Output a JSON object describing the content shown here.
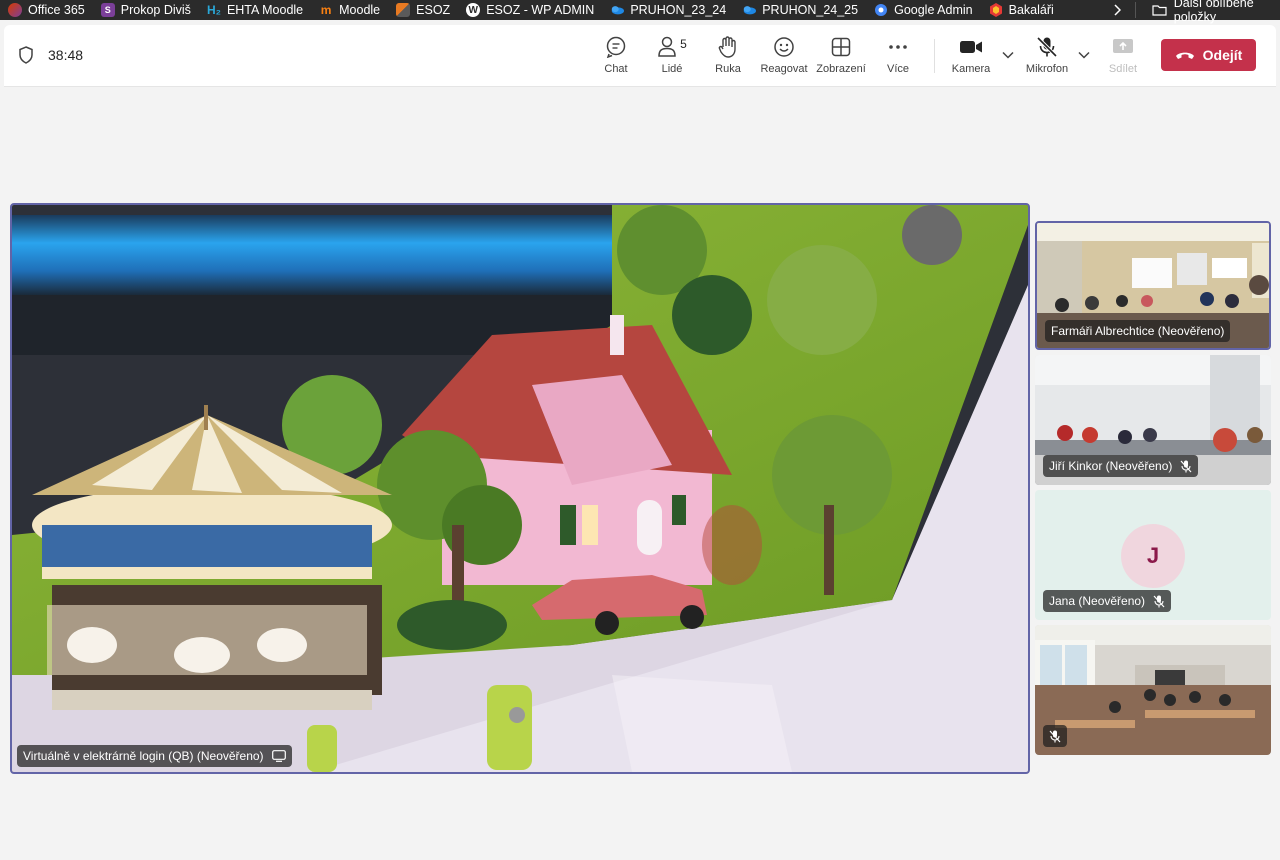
{
  "bookmarks": [
    {
      "label": "Office 365",
      "icon": "office-icon",
      "color": "#d83b01"
    },
    {
      "label": "Prokop Diviš",
      "icon": "prokop-icon",
      "color": "#7b3f99"
    },
    {
      "label": "EHTA Moodle",
      "icon": "ehta-h2-icon",
      "color": "#2aa8d8"
    },
    {
      "label": "Moodle",
      "icon": "moodle-icon",
      "color": "#f98012"
    },
    {
      "label": "ESOZ",
      "icon": "esoz-icon",
      "color": "#e87a22"
    },
    {
      "label": "ESOZ - WP ADMIN",
      "icon": "wordpress-icon",
      "color": "#ffffff"
    },
    {
      "label": "PRUHON_23_24",
      "icon": "onedrive-icon",
      "color": "#1e88e5"
    },
    {
      "label": "PRUHON_24_25",
      "icon": "onedrive-icon",
      "color": "#1e88e5"
    },
    {
      "label": "Google Admin",
      "icon": "google-admin-icon",
      "color": "#4285f4"
    },
    {
      "label": "Bakaláři",
      "icon": "bakalari-icon",
      "color": "#e53935"
    }
  ],
  "other_bookmarks": "Další oblíbené položky",
  "meeting": {
    "timer": "38:48",
    "people_count": "5",
    "buttons": {
      "chat": "Chat",
      "people": "Lidé",
      "hand": "Ruka",
      "react": "Reagovat",
      "view": "Zobrazení",
      "more": "Více",
      "camera": "Kamera",
      "mic": "Mikrofon",
      "share": "Sdílet"
    },
    "leave": "Odejít"
  },
  "stage": {
    "name": "Virtuálně v elektrárně login (QB) (Neověřeno)"
  },
  "participants": [
    {
      "name": "Farmáři Albrechtice (Neověřeno)",
      "muted": false
    },
    {
      "name": "Jiří Kinkor (Neověřeno)",
      "muted": true
    },
    {
      "name": "Jana (Neověřeno)",
      "muted": true,
      "initial": "J"
    },
    {
      "name": "",
      "muted": true
    }
  ],
  "colors": {
    "accent": "#6264a7",
    "leave": "#c4314b"
  }
}
